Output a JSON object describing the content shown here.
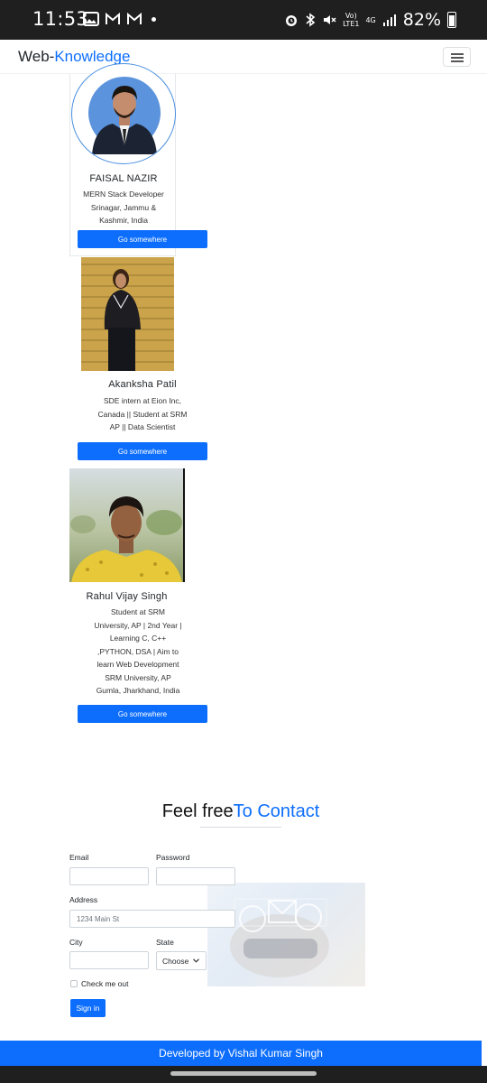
{
  "status_bar": {
    "time": "11:53",
    "net_top": "Vo)",
    "net_bottom": "LTE1",
    "net_gen": "4G",
    "battery": "82%"
  },
  "navbar": {
    "brand_prefix": "Web-",
    "brand_highlight": "Knowledge"
  },
  "cards": [
    {
      "name": "FAISAL NAZIR",
      "desc_lines": [
        "MERN Stack Developer",
        "Srinagar, Jammu &",
        "Kashmir, India"
      ],
      "button": "Go somewhere"
    },
    {
      "name": "Akanksha Patil",
      "desc_lines": [
        "SDE intern at Eion Inc,",
        "Canada || Student at SRM",
        "AP || Data Scientist"
      ],
      "button": "Go somewhere"
    },
    {
      "name": "Rahul Vijay Singh",
      "desc_lines": [
        "Student at SRM",
        "University, AP | 2nd Year |",
        "Learning C, C++",
        ",PYTHON, DSA | Aim to",
        "learn Web Development",
        "SRM University, AP",
        "Gumla, Jharkhand, India"
      ],
      "button": "Go somewhere"
    }
  ],
  "contact": {
    "title_prefix": "Feel free",
    "title_highlight": "To Contact",
    "email_label": "Email",
    "password_label": "Password",
    "address_label": "Address",
    "address_placeholder": "1234 Main St",
    "city_label": "City",
    "state_label": "State",
    "state_value": "Choose",
    "checkbox_label": "Check me out",
    "submit": "Sign in"
  },
  "footer": {
    "text": "Developed by Vishal Kumar Singh"
  },
  "colors": {
    "accent": "#0d6efd",
    "status_bar": "#1f1f1f"
  }
}
